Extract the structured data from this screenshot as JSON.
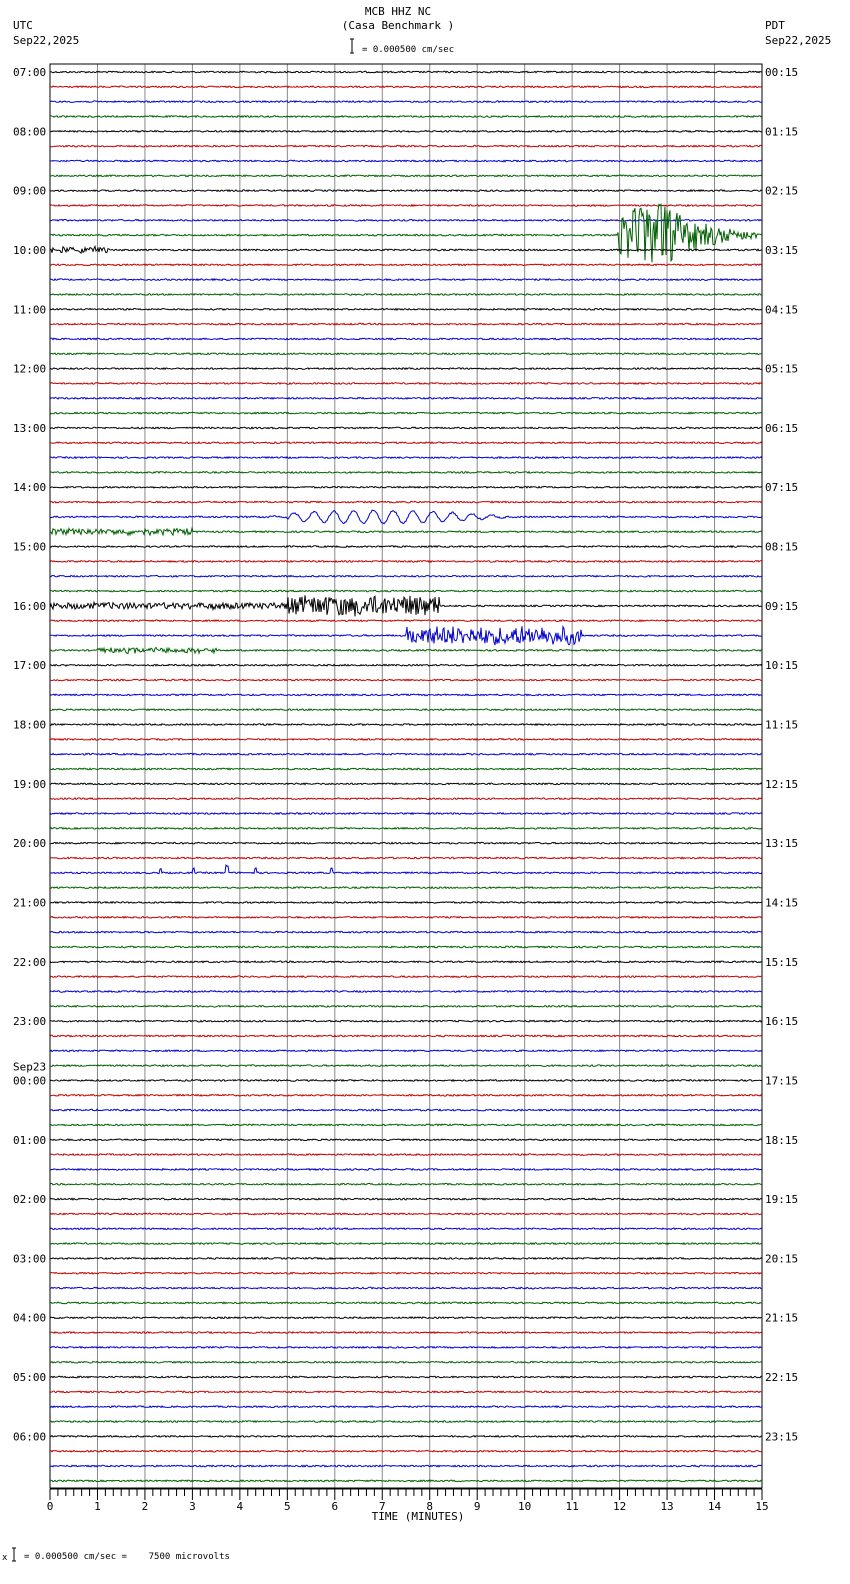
{
  "header": {
    "station": "MCB HHZ NC",
    "site": "(Casa Benchmark )",
    "left_tz": "UTC",
    "left_date": "Sep22,2025",
    "right_tz": "PDT",
    "right_date": "Sep22,2025",
    "scale": "= 0.000500 cm/sec"
  },
  "footer": {
    "scale": "= 0.000500 cm/sec =    7500 microvolts",
    "mark": "x"
  },
  "chart_data": {
    "type": "line",
    "title": "MCB HHZ NC (Casa Benchmark )",
    "xlabel": "TIME (MINUTES)",
    "xlim": [
      0,
      15
    ],
    "x_ticks": [
      "0",
      "1",
      "2",
      "3",
      "4",
      "5",
      "6",
      "7",
      "8",
      "9",
      "10",
      "11",
      "12",
      "13",
      "14",
      "15"
    ],
    "rows_per_hour": 4,
    "row_minutes": 15,
    "trace_colors": [
      "#000000",
      "#c00000",
      "#0000d0",
      "#006000"
    ],
    "left_labels": [
      "07:00",
      "08:00",
      "09:00",
      "10:00",
      "11:00",
      "12:00",
      "13:00",
      "14:00",
      "15:00",
      "16:00",
      "17:00",
      "18:00",
      "19:00",
      "20:00",
      "21:00",
      "22:00",
      "23:00",
      "00:00",
      "01:00",
      "02:00",
      "03:00",
      "04:00",
      "05:00",
      "06:00"
    ],
    "date_change_label": "Sep23",
    "date_change_hour_index": 17,
    "right_labels": [
      "00:15",
      "01:15",
      "02:15",
      "03:15",
      "04:15",
      "05:15",
      "06:15",
      "07:15",
      "08:15",
      "09:15",
      "10:15",
      "11:15",
      "12:15",
      "13:15",
      "14:15",
      "15:15",
      "16:15",
      "17:15",
      "18:15",
      "19:15",
      "20:15",
      "21:15",
      "22:15",
      "23:15"
    ],
    "events": [
      {
        "row": 11,
        "start_min": 11.95,
        "end_min": 15,
        "amplitude": 75,
        "kind": "earthquake"
      },
      {
        "row": 12,
        "start_min": 0,
        "end_min": 1.3,
        "amplitude": 3,
        "kind": "noise"
      },
      {
        "row": 30,
        "start_min": 4,
        "end_min": 11.2,
        "amplitude": 11,
        "kind": "surface-wave"
      },
      {
        "row": 31,
        "start_min": 0,
        "end_min": 3,
        "amplitude": 3,
        "kind": "noise"
      },
      {
        "row": 36,
        "start_min": 0,
        "end_min": 5,
        "amplitude": 3,
        "kind": "noise"
      },
      {
        "row": 36,
        "start_min": 5,
        "end_min": 8.2,
        "amplitude": 10,
        "kind": "burst"
      },
      {
        "row": 38,
        "start_min": 7.5,
        "end_min": 11.2,
        "amplitude": 9,
        "kind": "burst"
      },
      {
        "row": 39,
        "start_min": 1,
        "end_min": 3.5,
        "amplitude": 2.5,
        "kind": "noise"
      },
      {
        "row": 54,
        "start_min": 2.3,
        "end_min": 2.35,
        "amplitude": 4,
        "kind": "spike"
      },
      {
        "row": 54,
        "start_min": 3.0,
        "end_min": 3.05,
        "amplitude": 4,
        "kind": "spike"
      },
      {
        "row": 54,
        "start_min": 3.7,
        "end_min": 3.75,
        "amplitude": 7,
        "kind": "spike"
      },
      {
        "row": 54,
        "start_min": 4.3,
        "end_min": 4.35,
        "amplitude": 5,
        "kind": "spike"
      },
      {
        "row": 54,
        "start_min": 5.9,
        "end_min": 5.95,
        "amplitude": 4,
        "kind": "spike"
      }
    ]
  }
}
